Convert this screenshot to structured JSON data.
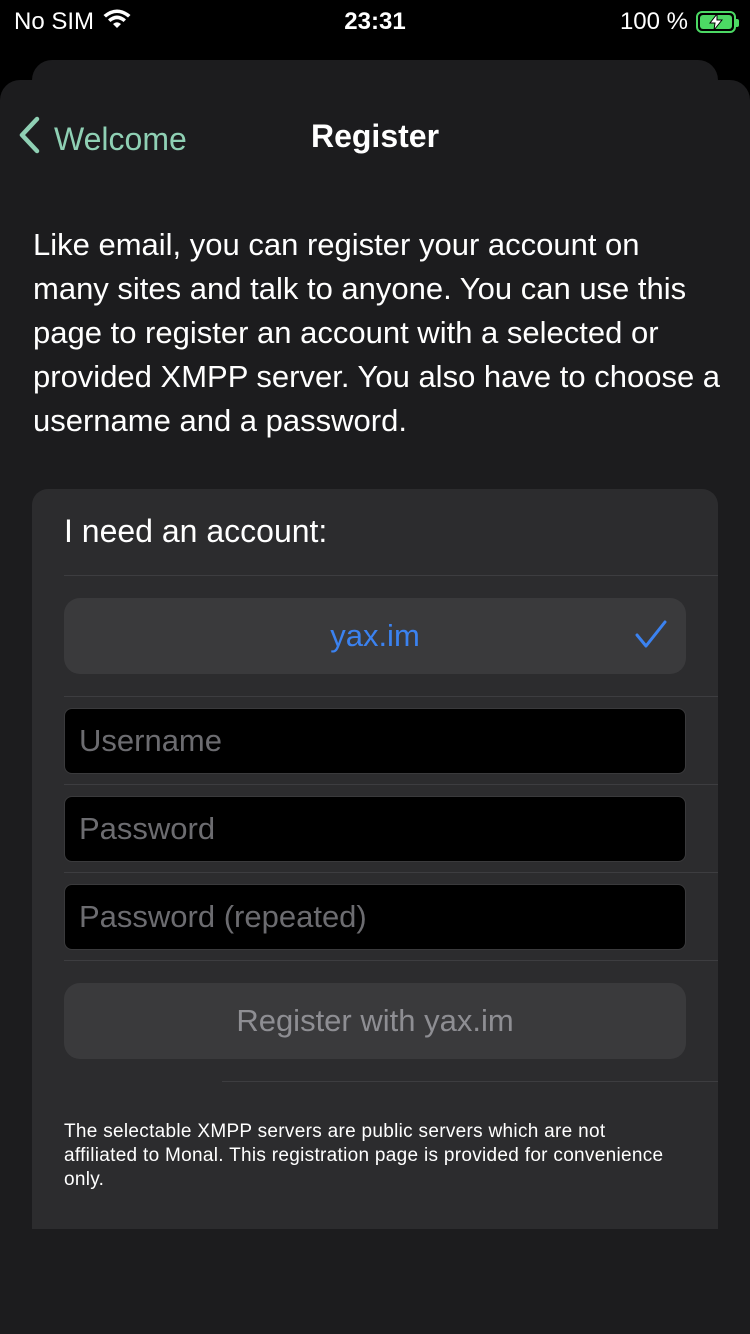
{
  "status_bar": {
    "carrier": "No SIM",
    "time": "23:31",
    "battery": "100 %"
  },
  "nav": {
    "back_label": "Welcome",
    "title": "Register"
  },
  "intro_text": "Like email, you can register your account on many sites and talk to anyone. You can use this page to register an account with a selected or provided XMPP server. You also have to choose a username and a password.",
  "form": {
    "heading": "I need an account:",
    "selected_server": "yax.im",
    "username_placeholder": "Username",
    "password_placeholder": "Password",
    "password_repeat_placeholder": "Password (repeated)",
    "register_button": "Register with yax.im"
  },
  "footnote": "The selectable XMPP servers are public servers which are not affiliated to Monal. This registration page is provided for convenience only.",
  "colors": {
    "accent_blue": "#3b82f0",
    "back_tint": "#8fd0b4",
    "battery_green": "#4cd964"
  }
}
